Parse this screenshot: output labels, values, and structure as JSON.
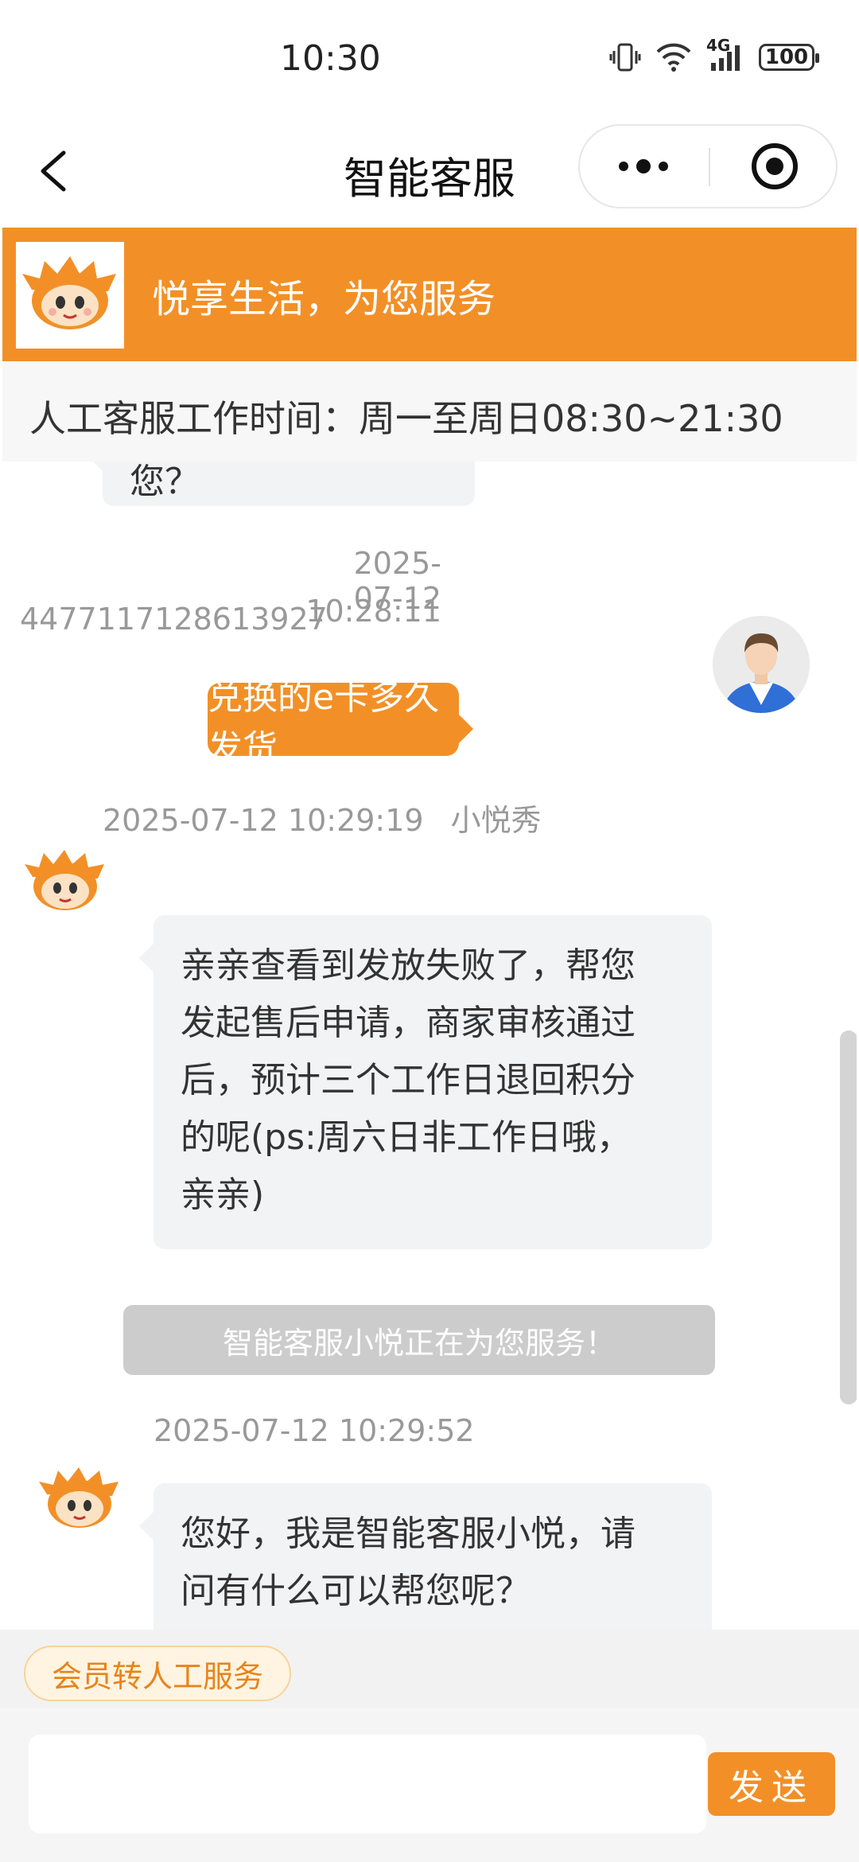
{
  "status_bar": {
    "time": "10:30",
    "network": "4G",
    "battery": "100"
  },
  "nav": {
    "title": "智能客服"
  },
  "banner": {
    "slogan": "悦享生活，为您服务"
  },
  "service_hours": "人工客服工作时间：周一至周日08:30~21:30",
  "chat": {
    "truncated_bubble_text": "您？",
    "messages": [
      {
        "sender": "user",
        "user_id": "4477117128613927",
        "date": "2025-07-12",
        "time": "10:28:11",
        "text": "兑换的e卡多久发货"
      },
      {
        "sender": "bot",
        "timestamp": "2025-07-12 10:29:19",
        "agent_name": "小悦秀",
        "lines": [
          "亲亲查看到发放失败了，帮您",
          "发起售后申请，商家审核通过",
          "后，预计三个工作日退回积分",
          "的呢(ps:周六日非工作日哦，",
          "亲亲)"
        ]
      },
      {
        "sender": "bot",
        "timestamp": "2025-07-12 10:29:52",
        "agent_name": "",
        "lines": [
          "您好，我是智能客服小悦，请",
          "问有什么可以帮您呢？"
        ]
      }
    ],
    "system_notice": "智能客服小悦正在为您服务！"
  },
  "quick_actions": {
    "transfer_label": "会员转人工服务"
  },
  "input": {
    "placeholder": "",
    "send_label": "发送"
  },
  "colors": {
    "brand": "#f29027",
    "bot_bubble": "#f2f3f5",
    "notice": "#cccccc"
  }
}
